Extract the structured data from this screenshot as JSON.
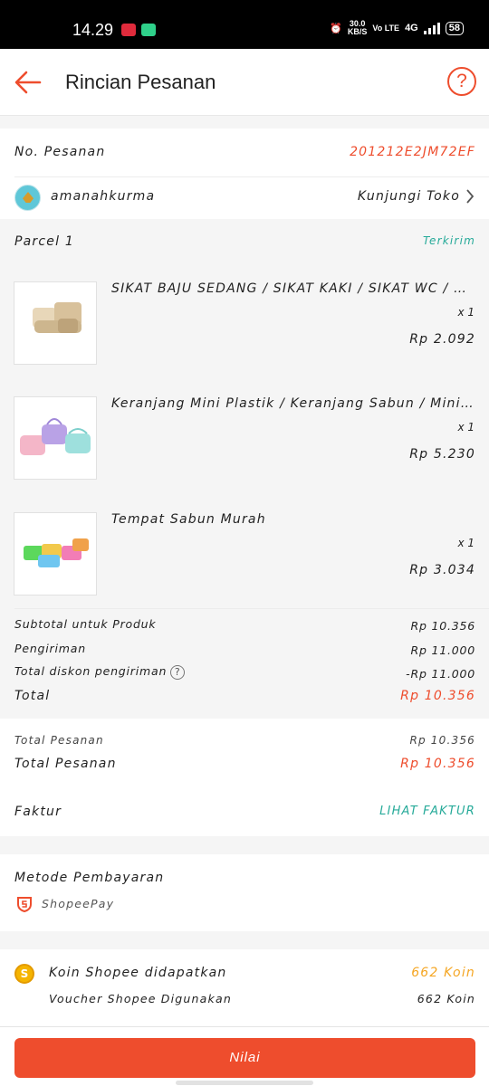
{
  "status_bar": {
    "time": "14.29",
    "speed_value": "30.0",
    "speed_unit": "KB/S",
    "volte": "Vo LTE",
    "network": "4G",
    "battery": "58"
  },
  "header": {
    "title": "Rincian Pesanan",
    "back_icon": "arrow-left-icon",
    "help_icon": "question-circle-icon",
    "help_glyph": "?"
  },
  "order": {
    "number_label": "No. Pesanan",
    "number_value": "201212E2JM72EF"
  },
  "shop": {
    "name": "amanahkurma",
    "visit_label": "Kunjungi Toko"
  },
  "parcel": {
    "label": "Parcel 1",
    "status": "Terkirim",
    "items": [
      {
        "name": "SIKAT BAJU SEDANG / SIKAT KAKI / SIKAT WC / SIKAT",
        "qty": "x 1",
        "price": "Rp 2.092"
      },
      {
        "name": "Keranjang Mini Plastik / Keranjang Sabun / Mini Basket",
        "qty": "x 1",
        "price": "Rp 5.230"
      },
      {
        "name": "Tempat Sabun Murah",
        "qty": "x 1",
        "price": "Rp 3.034"
      }
    ]
  },
  "summary": {
    "subtotal_label": "Subtotal untuk Produk",
    "subtotal_value": "Rp 10.356",
    "shipping_label": "Pengiriman",
    "shipping_value": "Rp 11.000",
    "shipping_discount_label": "Total diskon pengiriman",
    "shipping_discount_value": "-Rp 11.000",
    "total_label": "Total",
    "total_value": "Rp 10.356"
  },
  "order_total": {
    "label_small": "Total Pesanan",
    "value_small": "Rp 10.356",
    "label": "Total Pesanan",
    "value": "Rp 10.356"
  },
  "invoice": {
    "label": "Faktur",
    "link": "LIHAT FAKTUR"
  },
  "payment": {
    "title": "Metode Pembayaran",
    "method": "ShopeePay"
  },
  "coins": {
    "earned_label": "Koin Shopee didapatkan",
    "earned_value": "662 Koin",
    "voucher_label": "Voucher Shopee Digunakan",
    "voucher_value": "662 Koin"
  },
  "actions": {
    "rate_button": "Nilai"
  },
  "colors": {
    "accent": "#ee4d2d",
    "status_teal": "#26aa99",
    "coin_gold": "#f5a623"
  }
}
